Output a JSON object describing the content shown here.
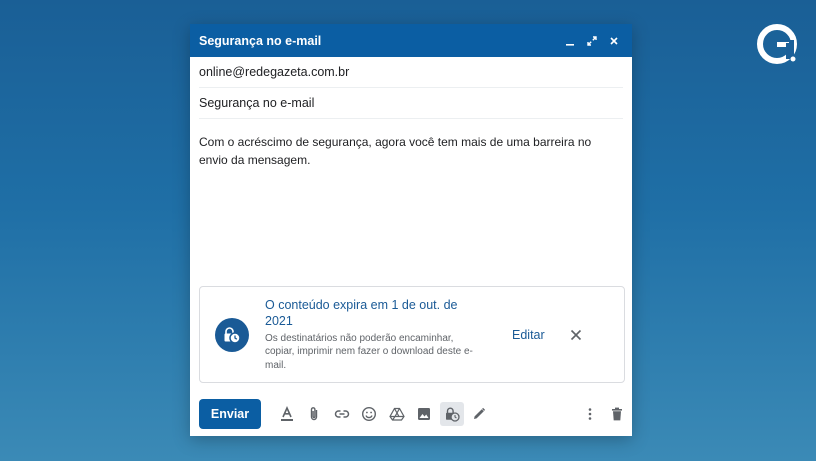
{
  "window": {
    "title": "Segurança no e-mail",
    "controls": [
      "minimize-icon",
      "expand-icon",
      "close-icon"
    ]
  },
  "compose": {
    "to": "online@redegazeta.com.br",
    "subject": "Segurança no e-mail",
    "body": "Com o acréscimo de segurança, agora você tem mais de uma barreira no envio da mensagem."
  },
  "confidential": {
    "headline": "O conteúdo expira em 1 de out. de 2021",
    "description": "Os destinatários não poderão encaminhar, copiar, imprimir nem fazer o download deste e-mail.",
    "edit_label": "Editar"
  },
  "toolbar": {
    "send_label": "Enviar"
  },
  "colors": {
    "primary": "#0b5ea3",
    "accent_text": "#1a5a96",
    "background_top": "#1a5f96",
    "background_bottom": "#3b8ab6"
  }
}
